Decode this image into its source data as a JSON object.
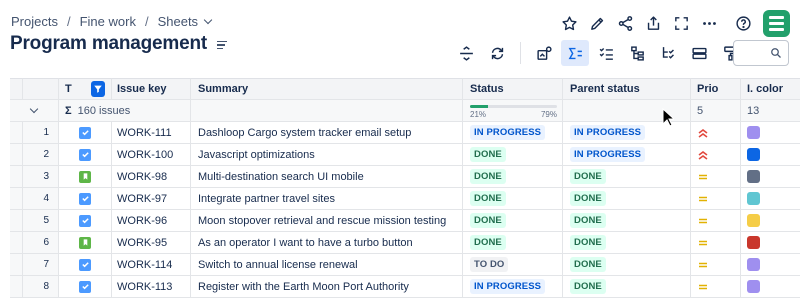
{
  "breadcrumb": {
    "items": [
      "Projects",
      "Fine work",
      "Sheets"
    ]
  },
  "page": {
    "title": "Program management"
  },
  "top_actions": [
    "star-icon",
    "pencil-icon",
    "share-icon",
    "export-icon",
    "fullscreen-icon",
    "more-icon",
    "help-icon"
  ],
  "toolbar": [
    "collapse-rows-icon",
    "refresh-icon",
    "image-settings-icon",
    "sum-icon",
    "checklist-icon",
    "hierarchy-icon",
    "tree-check-icon",
    "row-height-icon",
    "format-paint-icon"
  ],
  "search": {
    "placeholder": ""
  },
  "table": {
    "headers": {
      "type": "T",
      "key": "Issue key",
      "summary": "Summary",
      "status": "Status",
      "parent_status": "Parent status",
      "prio": "Prio",
      "color": "I. color"
    },
    "summary_row": {
      "sigma": "Σ",
      "issues": "160 issues",
      "progress_done": 0.21,
      "progress_left_label": "21%",
      "progress_right_label": "79%",
      "prio": "5",
      "color": "13"
    },
    "rows": [
      {
        "num": "1",
        "type": "task",
        "key": "WORK-111",
        "summary": "Dashloop Cargo system tracker email setup",
        "status": "IN PROGRESS",
        "parent_status": "IN PROGRESS",
        "prio": "high",
        "color": "#9f8fef"
      },
      {
        "num": "2",
        "type": "task",
        "key": "WORK-100",
        "summary": "Javascript optimizations",
        "status": "DONE",
        "parent_status": "IN PROGRESS",
        "prio": "high",
        "color": "#0c66e4"
      },
      {
        "num": "3",
        "type": "story",
        "key": "WORK-98",
        "summary": "Multi-destination search UI mobile",
        "status": "DONE",
        "parent_status": "DONE",
        "prio": "medium",
        "color": "#626f86"
      },
      {
        "num": "4",
        "type": "task",
        "key": "WORK-97",
        "summary": "Integrate partner travel sites",
        "status": "DONE",
        "parent_status": "DONE",
        "prio": "medium",
        "color": "#60c6d2"
      },
      {
        "num": "5",
        "type": "task",
        "key": "WORK-96",
        "summary": "Moon stopover retrieval and rescue mission testing",
        "status": "DONE",
        "parent_status": "DONE",
        "prio": "medium",
        "color": "#f5cd47"
      },
      {
        "num": "6",
        "type": "story",
        "key": "WORK-95",
        "summary": "As an operator I want to have a turbo button",
        "status": "DONE",
        "parent_status": "DONE",
        "prio": "medium",
        "color": "#c9372c"
      },
      {
        "num": "7",
        "type": "task",
        "key": "WORK-114",
        "summary": "Switch to annual license renewal",
        "status": "TO DO",
        "parent_status": "DONE",
        "prio": "medium",
        "color": "#9f8fef"
      },
      {
        "num": "8",
        "type": "task",
        "key": "WORK-113",
        "summary": "Register with the Earth Moon Port Authority",
        "status": "IN PROGRESS",
        "parent_status": "DONE",
        "prio": "medium",
        "color": "#9f8fef"
      }
    ]
  },
  "colors": {
    "accent": "#0c66e4",
    "logo": "#22a06b",
    "prio_high": "#e2483d",
    "prio_medium": "#e2b203"
  }
}
